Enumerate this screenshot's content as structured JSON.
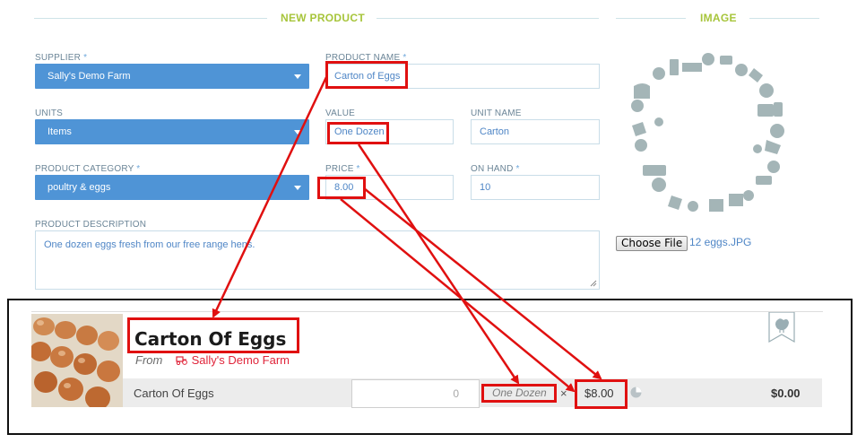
{
  "form": {
    "section_new_product": "NEW PRODUCT",
    "section_image": "IMAGE",
    "supplier": {
      "label": "SUPPLIER",
      "value": "Sally's Demo Farm"
    },
    "product_name": {
      "label": "PRODUCT NAME",
      "value": "Carton of Eggs"
    },
    "units": {
      "label": "UNITS",
      "value": "Items"
    },
    "value": {
      "label": "VALUE",
      "value": "One Dozen"
    },
    "unit_name": {
      "label": "UNIT NAME",
      "value": "Carton"
    },
    "product_category": {
      "label": "PRODUCT CATEGORY",
      "value": "poultry & eggs"
    },
    "price": {
      "label": "PRICE",
      "value": "8.00"
    },
    "on_hand": {
      "label": "ON HAND",
      "value": "10"
    },
    "description": {
      "label": "PRODUCT DESCRIPTION",
      "value": "One dozen eggs fresh from our free range hens."
    },
    "required_mark": "*"
  },
  "image_panel": {
    "choose_file_label": "Choose File",
    "file_name": "12 eggs.JPG",
    "icon_ring": "farm-icons-graphic"
  },
  "preview": {
    "title": "Carton Of Eggs",
    "from_label": "From",
    "farm_name": "Sally's Demo Farm",
    "row_name": "Carton Of Eggs",
    "quantity_placeholder": "0",
    "unit": "One Dozen",
    "times_symbol": "×",
    "price": "$8.00",
    "total": "$0.00",
    "category_icon": "chicken-icon"
  },
  "colors": {
    "accent_green": "#a7c53b",
    "select_blue": "#4f94d6",
    "highlight_red": "#e01010",
    "farm_red": "#e0243a"
  }
}
